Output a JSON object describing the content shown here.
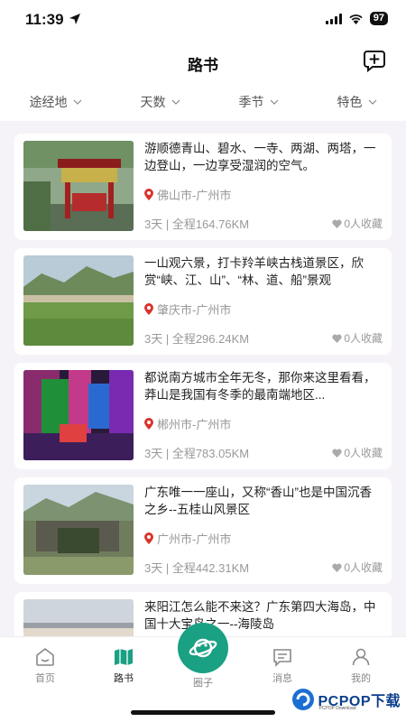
{
  "status": {
    "time": "11:39",
    "battery": "97"
  },
  "header": {
    "title": "路书"
  },
  "filters": [
    {
      "label": "途经地"
    },
    {
      "label": "天数"
    },
    {
      "label": "季节"
    },
    {
      "label": "特色"
    }
  ],
  "routes": [
    {
      "title": "游顺德青山、碧水、一寺、两湖、两塔，一边登山，一边享受湿润的空气。",
      "location": "佛山市-广州市",
      "meta": "3天 | 全程164.76KM",
      "favorites": "0人收藏"
    },
    {
      "title": "一山观六景，打卡羚羊峡古栈道景区，欣赏“峡、江、山”、“林、道、船”景观",
      "location": "肇庆市-广州市",
      "meta": "3天 | 全程296.24KM",
      "favorites": "0人收藏"
    },
    {
      "title": "都说南方城市全年无冬，那你来这里看看，莽山是我国有冬季的最南端地区...",
      "location": "郴州市-广州市",
      "meta": "3天 | 全程783.05KM",
      "favorites": "0人收藏"
    },
    {
      "title": "广东唯一一座山，又称“香山”也是中国沉香之乡--五桂山风景区",
      "location": "广州市-广州市",
      "meta": "3天 | 全程442.31KM",
      "favorites": "0人收藏"
    },
    {
      "title": "来阳江怎么能不来这？广东第四大海岛，中国十大宝岛之一--海陵岛",
      "location": "",
      "meta": "",
      "favorites": ""
    }
  ],
  "tabs": [
    {
      "label": "首页"
    },
    {
      "label": "路书"
    },
    {
      "label": "圈子"
    },
    {
      "label": "消息"
    },
    {
      "label": "我的"
    }
  ],
  "watermark": {
    "brand": "PCPOP下载",
    "sub": "PCPOP Download"
  },
  "colors": {
    "accent": "#1aa083",
    "pin": "#d9342b",
    "text_muted": "#999999"
  }
}
